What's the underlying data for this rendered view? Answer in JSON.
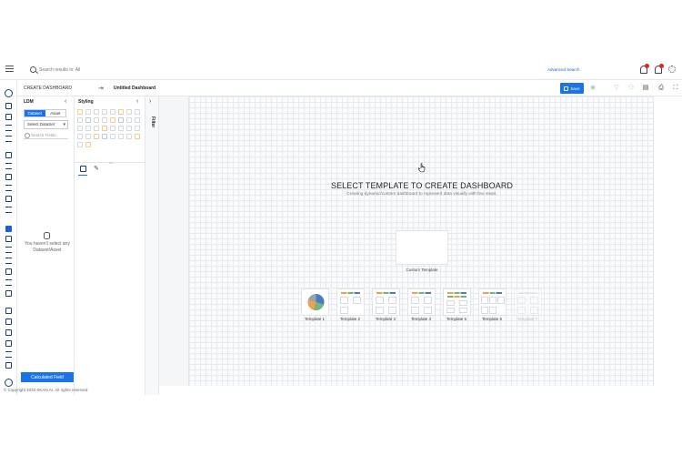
{
  "topbar": {
    "search_placeholder": "Search results in: All",
    "advanced_search": "Advanced Search"
  },
  "header": {
    "title": "CREATE DASHBOARD",
    "dashboard_name": "Untitled Dashboard",
    "save_label": "Save"
  },
  "ldm": {
    "title": "LDM",
    "segments": [
      "Dataset",
      "Asset"
    ],
    "select_label": "Select DataSet",
    "search_placeholder": "Search Fields",
    "empty_message": "You haven't select any Dataset/Asset",
    "calc_button": "Calculated Field"
  },
  "styling": {
    "title": "Styling"
  },
  "filter": {
    "label": "Filter"
  },
  "main": {
    "title": "SELECT TEMPLATE TO CREATE DASHBOARD",
    "subtitle": "Creating dynamic/custom dashboard to represent data visually with few steps.",
    "custom_template": "Custom Template",
    "templates": [
      "Template 1",
      "Template 2",
      "Template 3",
      "Template 4",
      "Template 5",
      "Template 6",
      "Template 7"
    ]
  },
  "footer": {
    "copyright": "© Copyright 2022 SKAN.AI. All rights reserved"
  },
  "colors": {
    "accent": "#1a73e8",
    "pie_blue": "#4a7cc0",
    "pie_orange": "#f0a04b",
    "pie_green": "#6fb77d",
    "pie_grey": "#9aa3ad"
  }
}
